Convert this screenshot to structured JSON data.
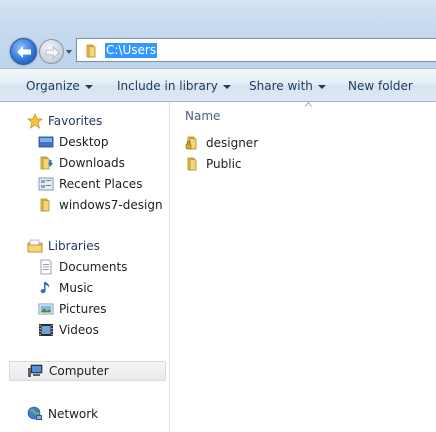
{
  "address": {
    "path": "C:\\Users"
  },
  "toolbar": {
    "organize": "Organize",
    "include_in_library": "Include in library",
    "share_with": "Share with",
    "new_folder": "New folder"
  },
  "navpane": {
    "favorites": {
      "header": "Favorites",
      "items": [
        "Desktop",
        "Downloads",
        "Recent Places",
        "windows7-design"
      ]
    },
    "libraries": {
      "header": "Libraries",
      "items": [
        "Documents",
        "Music",
        "Pictures",
        "Videos"
      ]
    },
    "computer": "Computer",
    "network": "Network"
  },
  "content": {
    "column_name": "Name",
    "files": [
      "designer",
      "Public"
    ]
  },
  "colors": {
    "selection": "#3399ff",
    "toolbar_text": "#1e395b",
    "header_text": "#1e395b"
  }
}
